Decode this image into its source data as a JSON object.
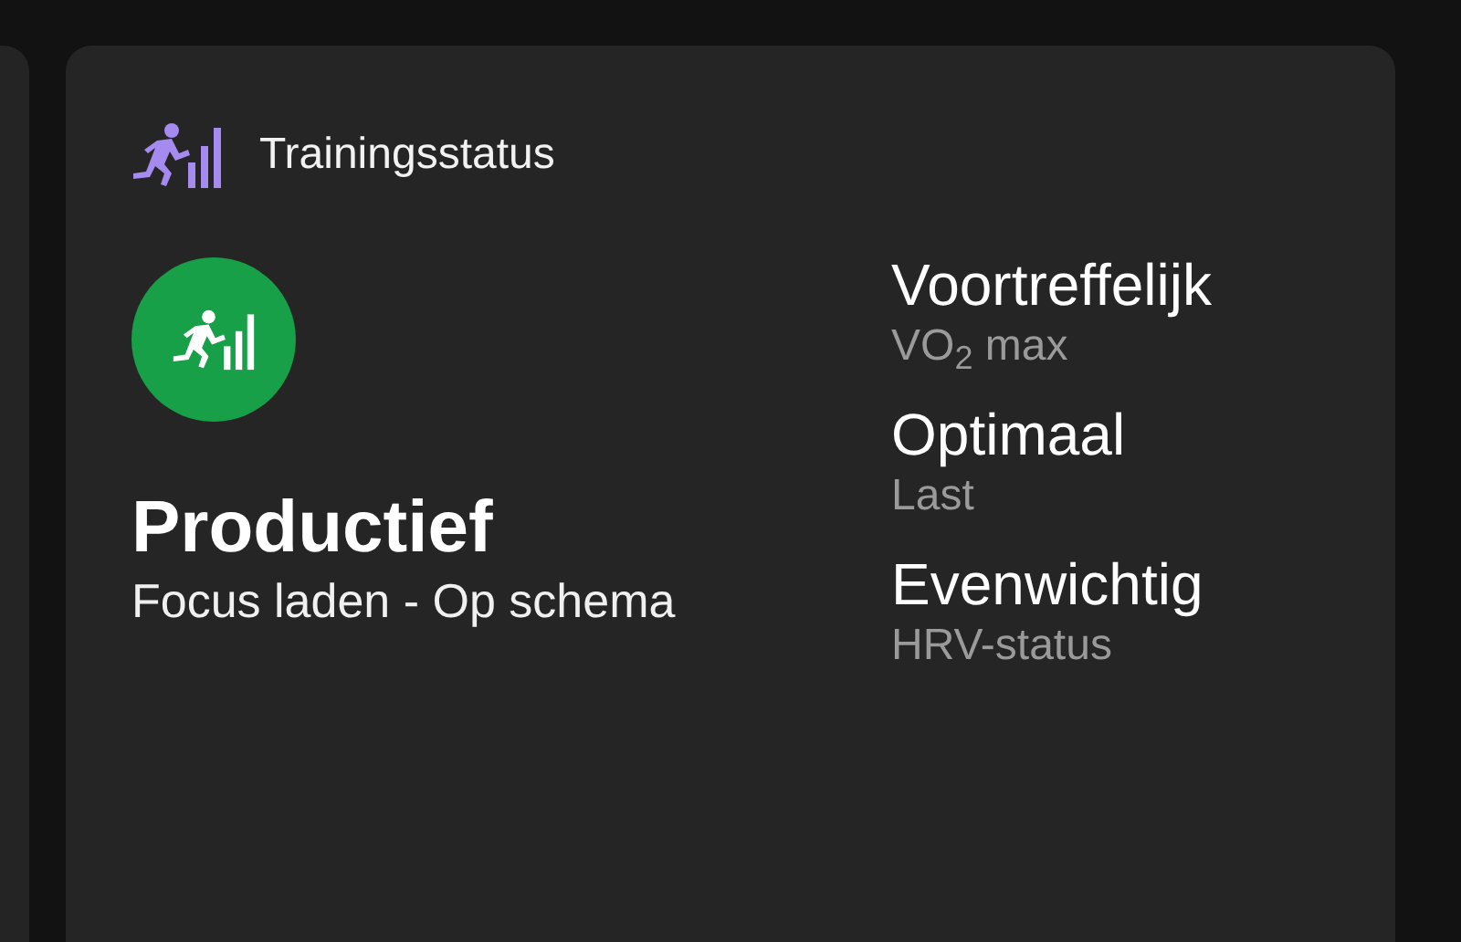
{
  "card": {
    "title": "Trainingsstatus",
    "status": {
      "label": "Productief",
      "detail": "Focus laden - Op schema"
    },
    "metrics": [
      {
        "value": "Voortreffelijk",
        "label": "VO$_{2}$ max"
      },
      {
        "value": "Optimaal",
        "label": "Last"
      },
      {
        "value": "Evenwichtig",
        "label": "HRV-status"
      }
    ]
  }
}
